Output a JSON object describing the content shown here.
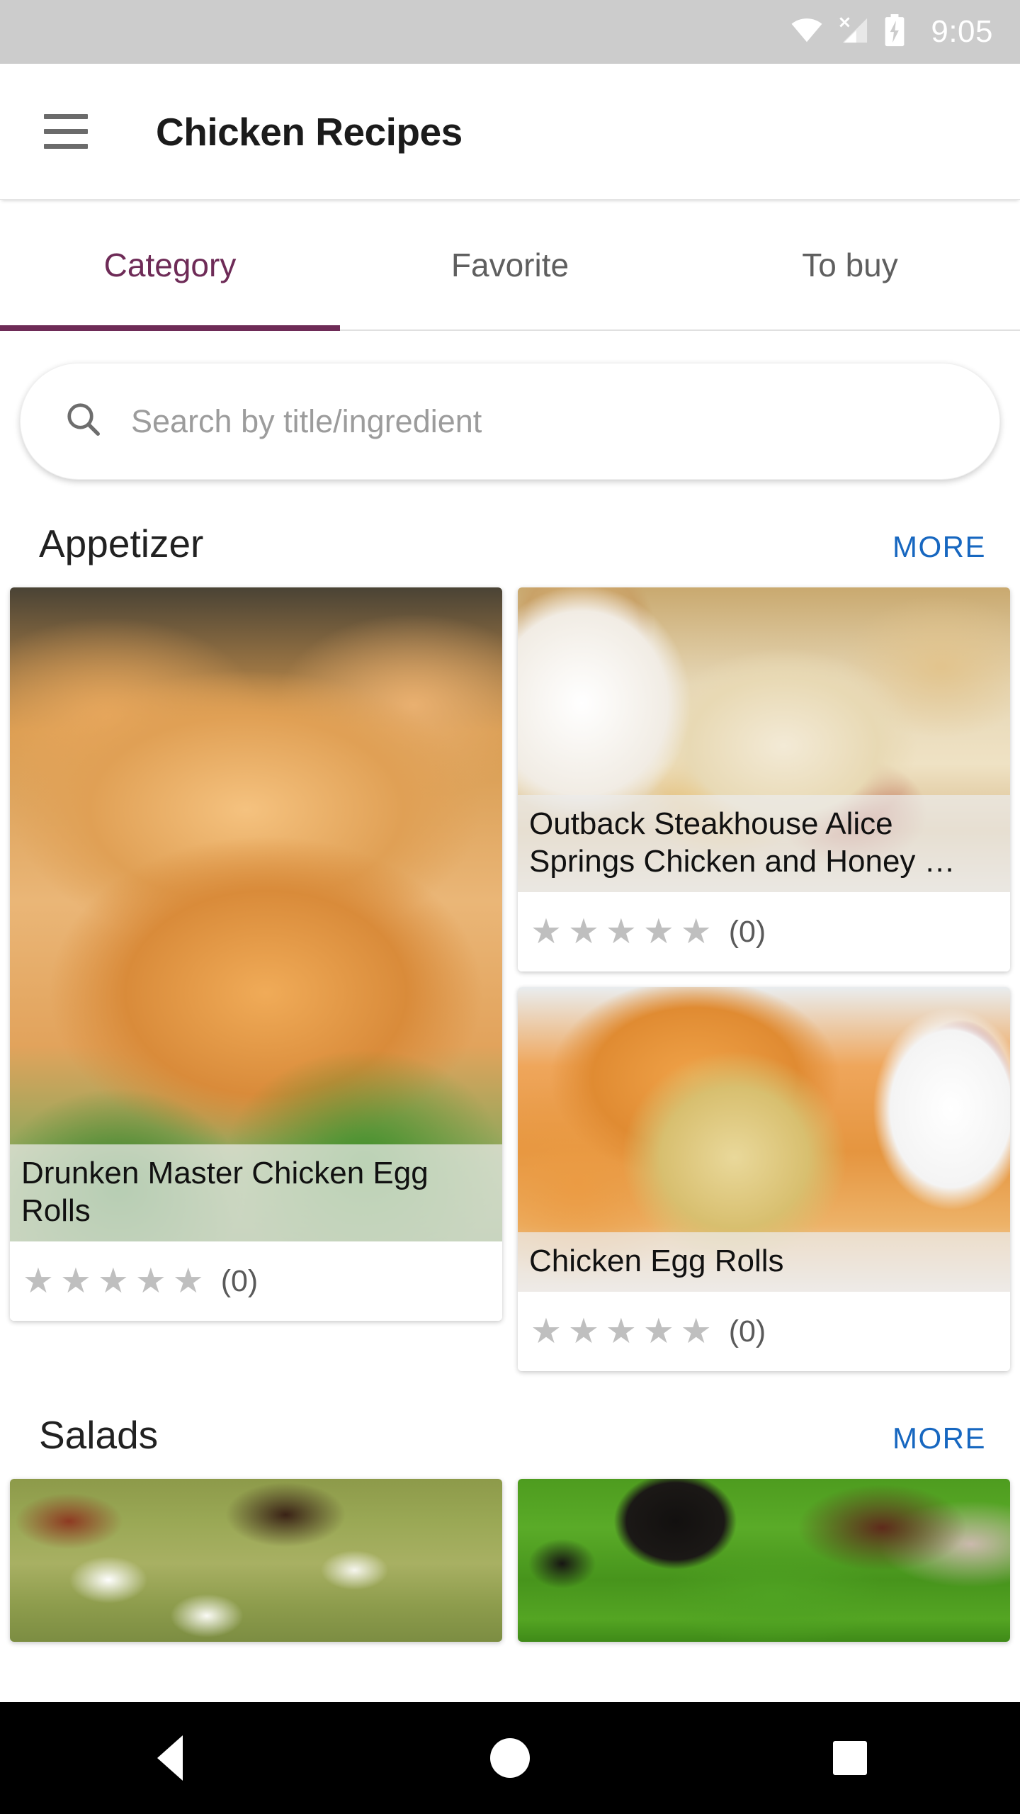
{
  "status_bar": {
    "time": "9:05",
    "icons": [
      "wifi-icon",
      "cellular-no-sim-icon",
      "battery-charging-icon"
    ],
    "background": "#cccccc"
  },
  "app_bar": {
    "menu_icon": "hamburger-menu-icon",
    "title": "Chicken Recipes"
  },
  "tabs": {
    "active_color": "#6e2b57",
    "active_index": 0,
    "items": [
      {
        "label": "Category"
      },
      {
        "label": "Favorite"
      },
      {
        "label": "To buy"
      }
    ]
  },
  "search": {
    "icon": "search-icon",
    "placeholder": "Search by title/ingredient",
    "value": ""
  },
  "sections": [
    {
      "title": "Appetizer",
      "more_label": "MORE",
      "more_color": "#1767c0",
      "cards": [
        {
          "title": "Drunken Master Chicken Egg\nRolls",
          "rating_stars": 5,
          "rating_filled": 0,
          "rating_count": "(0)",
          "image": "fried-chicken-egg-rolls-on-greens-photo"
        },
        {
          "title": "Outback Steakhouse Alice\nSprings Chicken and Honey …",
          "rating_stars": 5,
          "rating_filled": 0,
          "rating_count": "(0)",
          "image": "cheese-topped-chicken-with-honey-mustard-photo"
        },
        {
          "title": "Chicken Egg Rolls",
          "rating_stars": 5,
          "rating_filled": 0,
          "rating_count": "(0)",
          "image": "chicken-egg-rolls-with-red-dipping-sauce-photo"
        }
      ]
    },
    {
      "title": "Salads",
      "more_label": "MORE",
      "more_color": "#1767c0",
      "cards": [
        {
          "title": "",
          "image": "sprout-salad-photo"
        },
        {
          "title": "",
          "image": "arugula-olive-salad-photo"
        }
      ]
    }
  ],
  "nav_bar": {
    "background": "#000000",
    "buttons": [
      {
        "name": "back-button",
        "icon": "triangle-back-icon"
      },
      {
        "name": "home-button",
        "icon": "circle-home-icon"
      },
      {
        "name": "recents-button",
        "icon": "square-recents-icon"
      }
    ]
  },
  "star_glyph": "★"
}
